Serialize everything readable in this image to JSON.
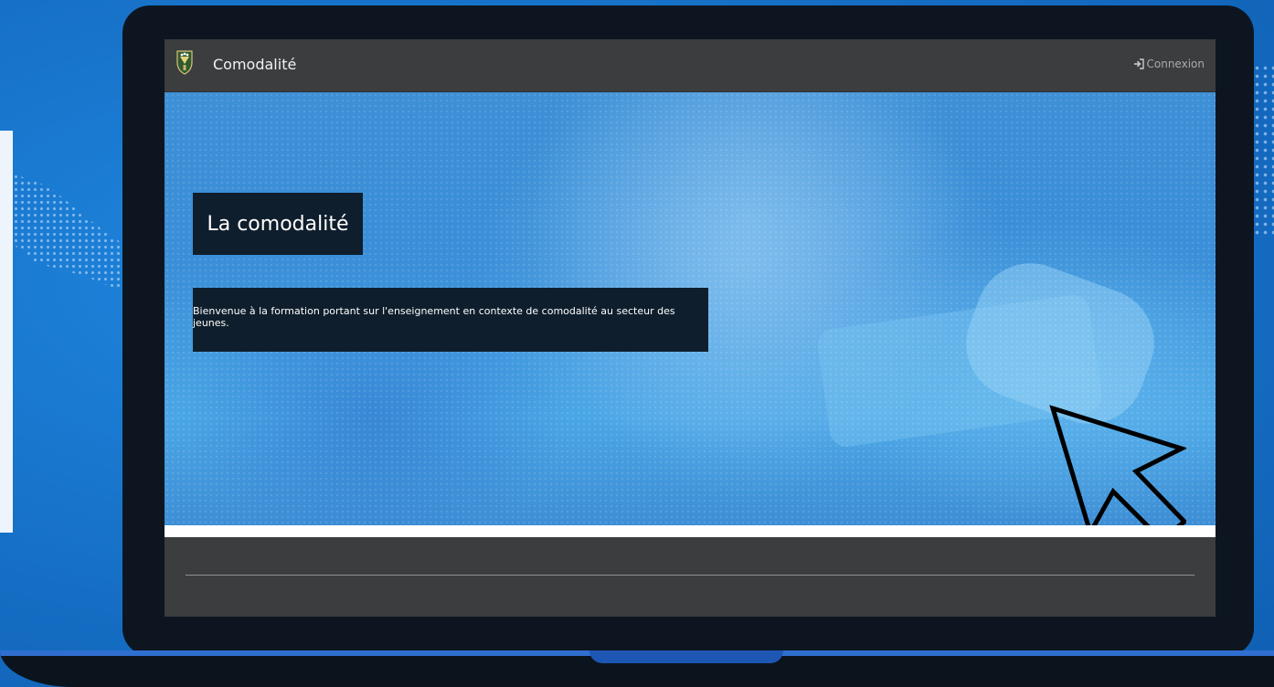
{
  "navbar": {
    "brand": "Comodalité",
    "login_label": "Connexion"
  },
  "hero": {
    "title": "La comodalité",
    "subtitle": "Bienvenue à la formation portant sur l'enseignement en contexte de comodalité au secteur des jeunes.",
    "slide_count": 2,
    "active_slide": 1
  },
  "icons": {
    "logo": "crest-logo-icon",
    "login": "sign-in-icon",
    "cursor": "mouse-pointer-icon"
  },
  "colors": {
    "navbar_bg": "#3b3d3f",
    "caption_bg": "#0f1e2c",
    "hero_blue": "#3a8fd8",
    "page_bg": "#1a73c9"
  }
}
